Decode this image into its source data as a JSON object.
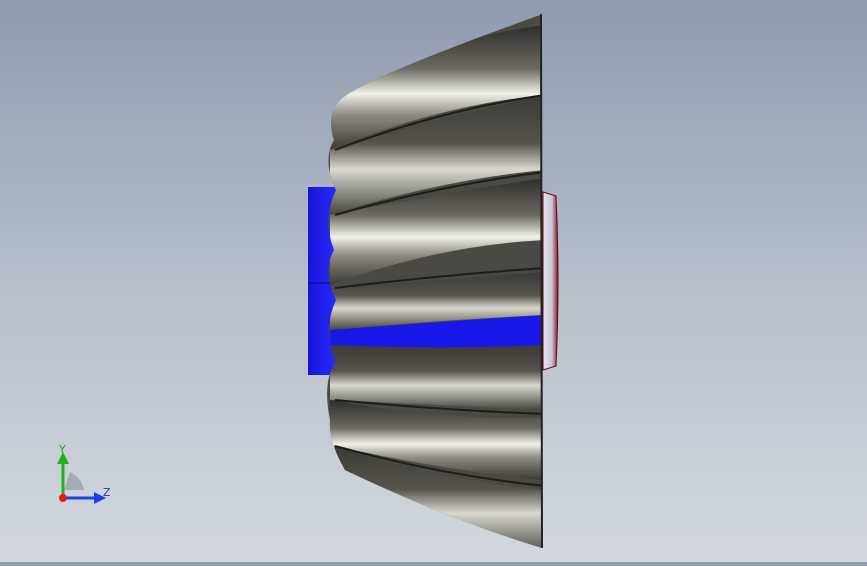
{
  "viewport": {
    "background_top": "#8f9cae",
    "background_bottom": "#d3d8de",
    "model": "spiral-bevel-gear",
    "hub_color": "#1d1ff0",
    "tooth_color_dark": "#3c3a35",
    "tooth_color_light": "#eeeee8",
    "flange_color": "#b8101a"
  },
  "triad": {
    "y_label": "Y",
    "z_label": "Z",
    "x_color": "#e81a1a",
    "y_color": "#22b022",
    "z_color": "#1a44e8"
  }
}
